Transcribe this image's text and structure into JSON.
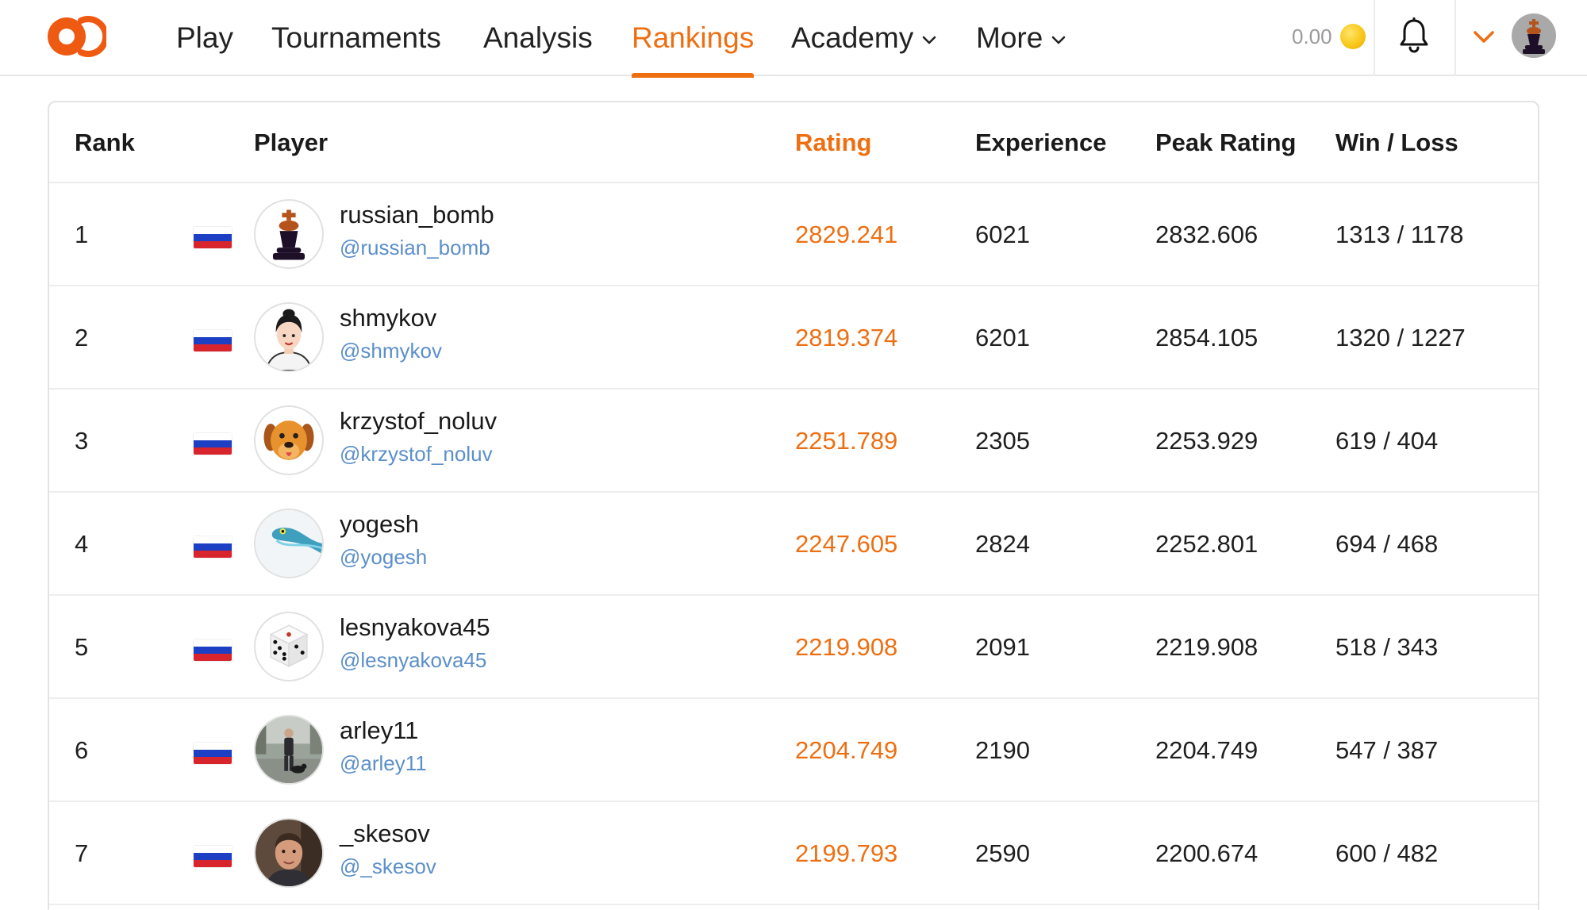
{
  "nav": {
    "items": [
      {
        "label": "Play"
      },
      {
        "label": "Tournaments"
      },
      {
        "label": "Analysis"
      },
      {
        "label": "Rankings"
      },
      {
        "label": "Academy"
      },
      {
        "label": "More"
      }
    ],
    "balance": "0.00"
  },
  "colors": {
    "accent": "#ee6f12",
    "handle": "#5c8fc8"
  },
  "table": {
    "headers": {
      "rank": "Rank",
      "player": "Player",
      "rating": "Rating",
      "experience": "Experience",
      "peak": "Peak Rating",
      "winloss": "Win / Loss"
    },
    "rows": [
      {
        "rank": "1",
        "name": "russian_bomb",
        "handle": "@russian_bomb",
        "rating": "2829.241",
        "experience": "6021",
        "peak": "2832.606",
        "winloss": "1313 / 1178",
        "avatar": "chess-king-icon"
      },
      {
        "rank": "2",
        "name": "shmykov",
        "handle": "@shmykov",
        "rating": "2819.374",
        "experience": "6201",
        "peak": "2854.105",
        "winloss": "1320 / 1227",
        "avatar": "person-portrait-icon"
      },
      {
        "rank": "3",
        "name": "krzystof_noluv",
        "handle": "@krzystof_noluv",
        "rating": "2251.789",
        "experience": "2305",
        "peak": "2253.929",
        "winloss": "619 / 404",
        "avatar": "dog-icon"
      },
      {
        "rank": "4",
        "name": "yogesh",
        "handle": "@yogesh",
        "rating": "2247.605",
        "experience": "2824",
        "peak": "2252.801",
        "winloss": "694 / 468",
        "avatar": "snake-icon"
      },
      {
        "rank": "5",
        "name": "lesnyakova45",
        "handle": "@lesnyakova45",
        "rating": "2219.908",
        "experience": "2091",
        "peak": "2219.908",
        "winloss": "518 / 343",
        "avatar": "dice-icon"
      },
      {
        "rank": "6",
        "name": "arley11",
        "handle": "@arley11",
        "rating": "2204.749",
        "experience": "2190",
        "peak": "2204.749",
        "winloss": "547 / 387",
        "avatar": "photo-person-with-dog-icon"
      },
      {
        "rank": "7",
        "name": "_skesov",
        "handle": "@_skesov",
        "rating": "2199.793",
        "experience": "2590",
        "peak": "2200.674",
        "winloss": "600 / 482",
        "avatar": "photo-face-icon"
      }
    ]
  }
}
